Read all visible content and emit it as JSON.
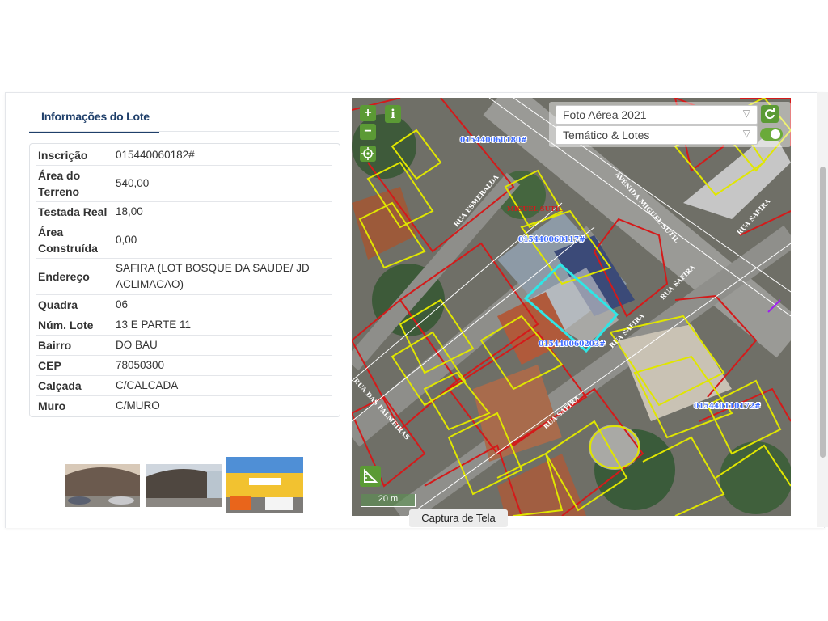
{
  "tab": {
    "label": "Informações do Lote"
  },
  "fields": [
    {
      "label": "Inscrição",
      "value": "015440060182#"
    },
    {
      "label": "Área do Terreno",
      "value": "540,00"
    },
    {
      "label": "Testada Real",
      "value": "18,00"
    },
    {
      "label": "Área Construída",
      "value": "0,00"
    },
    {
      "label": "Endereço",
      "value": "SAFIRA (LOT BOSQUE DA SAUDE/ JD ACLIMACAO)"
    },
    {
      "label": "Quadra",
      "value": "06"
    },
    {
      "label": "Núm. Lote",
      "value": "13 E PARTE 11"
    },
    {
      "label": "Bairro",
      "value": "DO BAU"
    },
    {
      "label": "CEP",
      "value": "78050300"
    },
    {
      "label": "Calçada",
      "value": "C/CALCADA"
    },
    {
      "label": "Muro",
      "value": "C/MURO"
    }
  ],
  "map": {
    "base_layer": "Foto Aérea 2021",
    "overlay_layer": "Temático & Lotes",
    "zoom_in": "+",
    "zoom_out": "−",
    "info": "i",
    "scale": "20 m",
    "tooltip": "Captura de Tela",
    "labels": {
      "lot1": "015440060180#",
      "lot2": "015440060117#",
      "lot3": "015440060203#",
      "lot4": "015440110172#",
      "street1": "RUA ESMERALDA",
      "street2": "MIGUEL SUTIL",
      "street3": "AVENIDA MIGUEL SUTIL",
      "street4": "RUA SAFIRA",
      "street5": "RUA SAFIRA",
      "street6": "RUA SAFIRA",
      "street7": "RUA SAFIRA",
      "street8": "RUA DAS PALMEIRAS"
    },
    "colors": {
      "lot_lines": "#e0e600",
      "parcel_lines": "#d41a1a",
      "selected": "#2ee6e6",
      "label": "#3e6cff",
      "control": "#5b9a35"
    }
  }
}
